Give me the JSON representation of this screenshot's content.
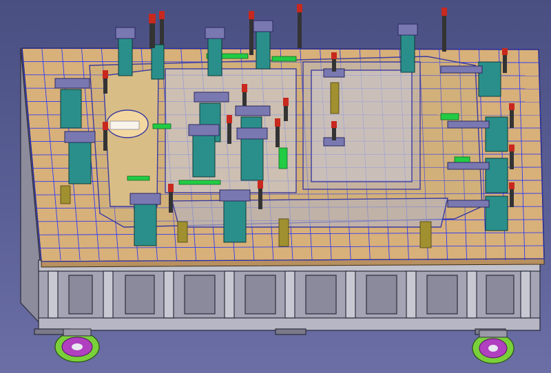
{
  "viewport": {
    "name": "3d-viewport",
    "background_top": "#4a4f82",
    "background_bottom": "#6b6fa5"
  },
  "model": {
    "name": "welding-fixture-assembly",
    "colors": {
      "plate": "#d8b07a",
      "plate_grid": "#1a2cff",
      "frame": "#9a9aa8",
      "clamp_body": "#2a8f8a",
      "clamp_arm": "#7a78b0",
      "handle": "#c8281e",
      "part_outline": "#3a3aa0",
      "locator_green": "#22cc44",
      "support_olive": "#a09030",
      "caster": "#7ad03a",
      "caster_hub": "#b040c0"
    }
  }
}
